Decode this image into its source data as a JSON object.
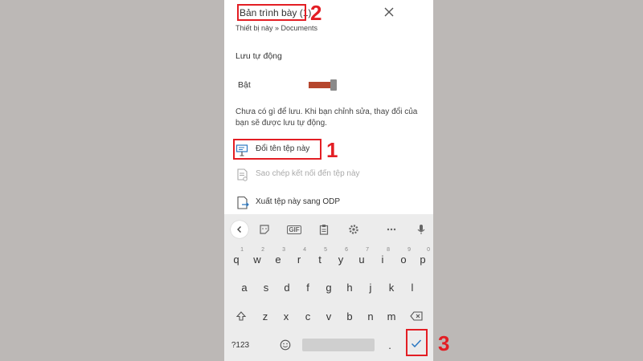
{
  "header": {
    "title": "Bản trình bày (1)",
    "breadcrumb": "Thiết bị này » Documents"
  },
  "autosave": {
    "section_label": "Lưu tự động",
    "toggle_label": "Bật",
    "toggle_on": true,
    "toggle_color": "#b5462d",
    "description": "Chưa có gì để lưu. Khi bạn chỉnh sửa, thay đổi của bạn sẽ được lưu tự động."
  },
  "actions": [
    {
      "label": "Đổi tên tệp này",
      "icon": "rename-icon",
      "enabled": true
    },
    {
      "label": "Sao chép kết nối đến tệp này",
      "icon": "copy-link-icon",
      "enabled": false
    },
    {
      "label": "Xuất tệp này sang ODP",
      "icon": "export-icon",
      "enabled": true
    }
  ],
  "keyboard": {
    "toolbar": {
      "gif_label": "GIF"
    },
    "row1": [
      "q",
      "w",
      "e",
      "r",
      "t",
      "y",
      "u",
      "i",
      "o",
      "p"
    ],
    "row1_hints": [
      "1",
      "2",
      "3",
      "4",
      "5",
      "6",
      "7",
      "8",
      "9",
      "0"
    ],
    "row2": [
      "a",
      "s",
      "d",
      "f",
      "g",
      "h",
      "j",
      "k",
      "l"
    ],
    "row3": [
      "z",
      "x",
      "c",
      "v",
      "b",
      "n",
      "m"
    ],
    "symbols_key": "?123",
    "period_key": ".",
    "enter_icon": "checkmark-icon"
  },
  "annotations": {
    "n1": "1",
    "n2": "2",
    "n3": "3",
    "color": "#e31e24"
  }
}
